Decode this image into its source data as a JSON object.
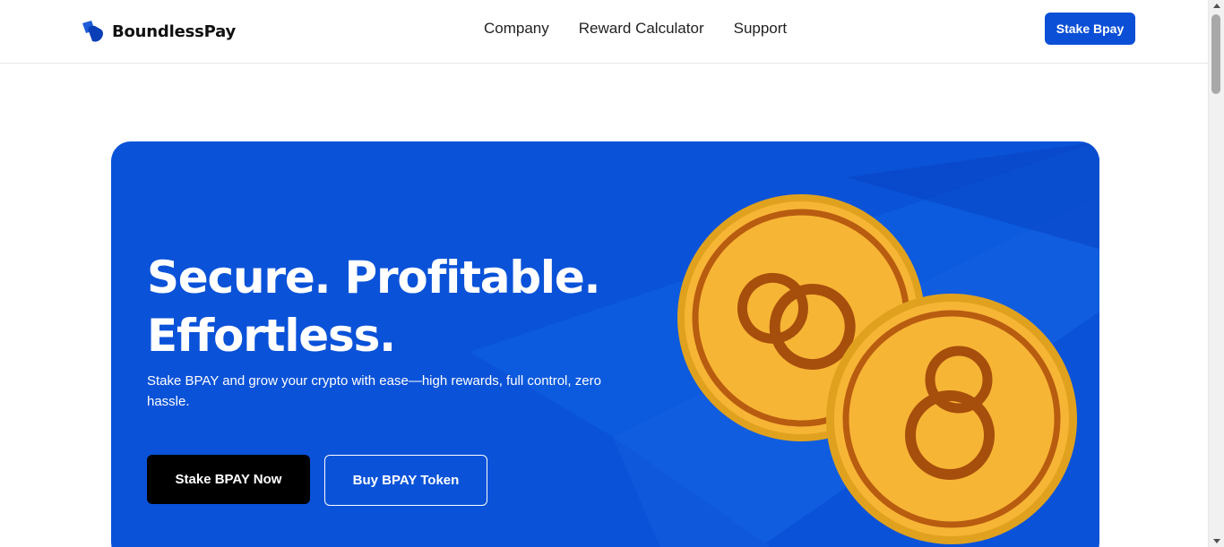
{
  "brand": {
    "name": "BoundlessPay"
  },
  "nav": {
    "items": [
      {
        "label": "Company"
      },
      {
        "label": "Reward Calculator"
      },
      {
        "label": "Support"
      }
    ],
    "cta_label": "Stake Bpay"
  },
  "hero": {
    "title_line1": "Secure. Profitable.",
    "title_line2": "Effortless.",
    "subtitle": "Stake BPAY and grow your crypto with ease—high rewards, full control, zero hassle.",
    "primary_button": "Stake BPAY Now",
    "secondary_button": "Buy BPAY Token"
  },
  "colors": {
    "accent": "#0a4fd6",
    "hero_bg": "#0a52d8",
    "coin_gold": "#f7b536",
    "coin_ring": "#b85c10"
  }
}
